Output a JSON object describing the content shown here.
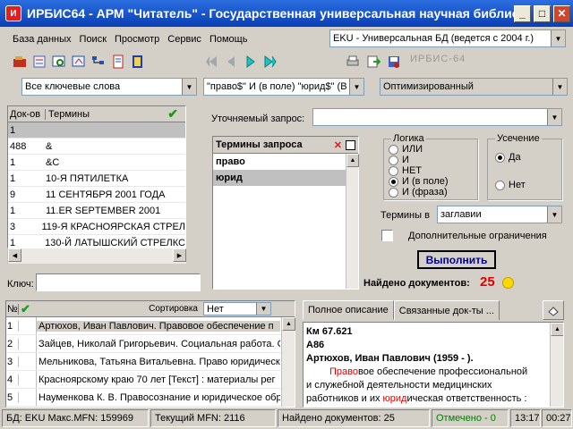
{
  "window": {
    "title": "ИРБИС64 - АРМ \"Читатель\" - Государственная универсальная научная библиотек..."
  },
  "menu": [
    "База данных",
    "Поиск",
    "Просмотр",
    "Сервис",
    "Помощь"
  ],
  "database_select": "EKU - Универсальная БД (ведется с 2004 г.)",
  "toolbar_right_text": "ИРБИС-64",
  "search": {
    "mode": "Все ключевые слова",
    "query": "\"право$\" И (в поле) \"юрид$\" (В",
    "method": "Оптимизированный"
  },
  "terms_table": {
    "headers": [
      "Док-ов",
      "Термины"
    ],
    "rows": [
      [
        "1",
        ""
      ],
      [
        "488",
        "&"
      ],
      [
        "1",
        "&C"
      ],
      [
        "1",
        "10-Я ПЯТИЛЕТКА"
      ],
      [
        "9",
        "11 СЕНТЯБРЯ 2001 ГОДА"
      ],
      [
        "1",
        "11.ER SEPTEMBER 2001"
      ],
      [
        "3",
        "119-Я КРАСНОЯРСКАЯ СТРЕЛ"
      ],
      [
        "1",
        "130-Й ЛАТЫШСКИЙ СТРЕЛКС"
      ]
    ]
  },
  "key_label": "Ключ:",
  "refine_label": "Уточняемый запрос:",
  "query_terms": {
    "title": "Термины запроса",
    "items": [
      "право",
      "юрид"
    ]
  },
  "logic": {
    "title": "Логика",
    "options": [
      "ИЛИ",
      "И",
      "НЕТ",
      "И (в поле)",
      "И (фраза)"
    ],
    "selected": 3
  },
  "truncation": {
    "title": "Усечение",
    "options": [
      "Да",
      "Нет"
    ],
    "selected": 0
  },
  "terms_in_label": "Термины в",
  "terms_in_value": "заглавии",
  "extra_limits": "Дополнительные ограничения",
  "run_button": "Выполнить",
  "found_label": "Найдено документов:",
  "found_count": "25",
  "results": {
    "sort_label": "Сортировка",
    "sort_value": "Нет",
    "headers": [
      "№"
    ],
    "rows": [
      [
        "1",
        "Артюхов, Иван Павлович. Правовое обеспечение п"
      ],
      [
        "2",
        "Зайцев, Николай Григорьевич. Социальная работа. С"
      ],
      [
        "3",
        "Мельникова, Татьяна Витальевна. Право юридическ"
      ],
      [
        "4",
        "Красноярскому краю 70 лет [Текст] : материалы рег"
      ],
      [
        "5",
        "Науменкова К. В. Правосознание и юридическое обр"
      ]
    ]
  },
  "tabs": [
    "Полное описание",
    "Связанные док-ты ..."
  ],
  "description": {
    "line1": "Км 67.621",
    "line2": "А86",
    "line3": "Артюхов, Иван Павлович (1959 - ).",
    "hl1": "Право",
    "text1": "вое обеспечение профессиональной",
    "text2": "и служебной деятельности медицинских",
    "text3a": "работников и их ",
    "hl2": "юрид",
    "text3b": "ическая ответственность :"
  },
  "status": {
    "db": "БД: EKU Макс.MFN: 159969",
    "mfn": "Текущий MFN: 2116",
    "found": "Найдено документов: 25",
    "marked": "Отмечено - 0",
    "time1": "13:17",
    "time2": "00:27"
  },
  "colors": {
    "title_bar": "#0a3fb4",
    "highlight": "#e00000",
    "found": "#e00000",
    "marked": "#008000"
  }
}
